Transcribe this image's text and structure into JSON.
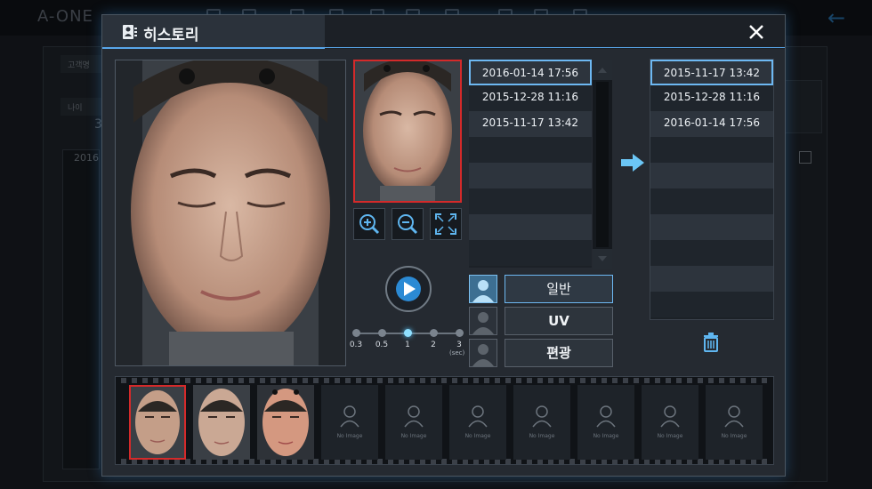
{
  "app": {
    "logo": "A-ONE"
  },
  "background": {
    "customer_label": "고객명",
    "age_label": "나이",
    "age_value": "3",
    "date_prefix": "2016"
  },
  "dialog": {
    "title": "히스토리",
    "title_icon": "person-card-icon",
    "close_icon": "close-icon"
  },
  "viewer": {
    "zoom_in_icon": "zoom-in-icon",
    "zoom_out_icon": "zoom-out-icon",
    "fit_icon": "fit-screen-icon",
    "play_icon": "play-icon"
  },
  "speed": {
    "options": [
      "0.3",
      "0.5",
      "1",
      "2",
      "3"
    ],
    "selected": "1",
    "unit": "(sec)"
  },
  "history_list": [
    "2016-01-14 17:56",
    "2015-12-28 11:16",
    "2015-11-17 13:42"
  ],
  "history_selected": "2016-01-14 17:56",
  "compare_list": [
    "2015-11-17 13:42",
    "2015-12-28 11:16",
    "2016-01-14 17:56"
  ],
  "compare_selected": "2015-11-17 13:42",
  "modes": [
    {
      "label": "일반",
      "active": true
    },
    {
      "label": "UV",
      "active": false
    },
    {
      "label": "편광",
      "active": false
    }
  ],
  "filmstrip": {
    "no_image_label": "No Image",
    "filled_slots": 3,
    "total_slots": 10
  },
  "colors": {
    "accent": "#58a6ea",
    "selection_red": "#d42a2a",
    "active_dot": "#8fe0ff"
  }
}
